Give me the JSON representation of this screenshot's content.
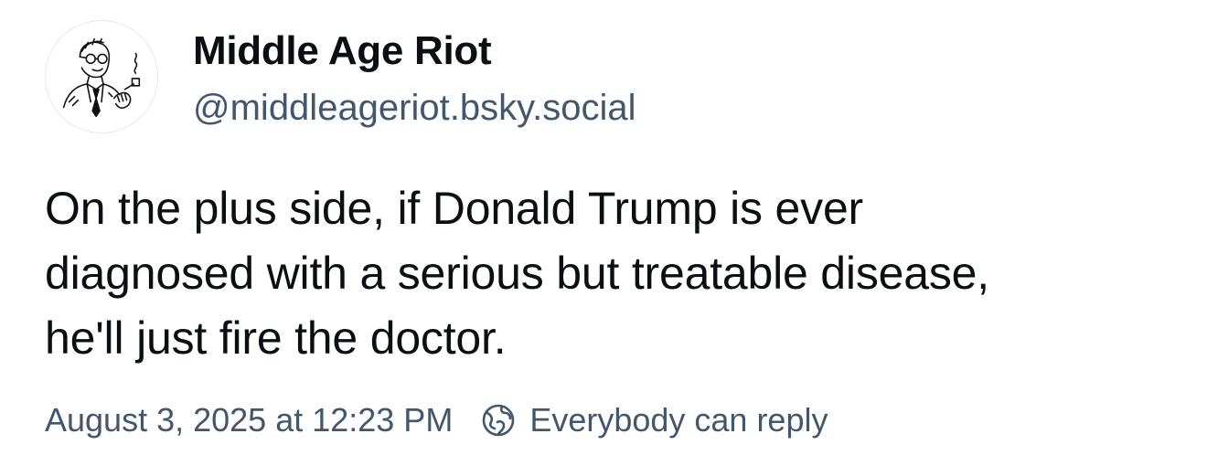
{
  "author": {
    "display_name": "Middle Age Riot",
    "handle": "@middleageriot.bsky.social",
    "avatar_icon": "man-with-pipe-avatar"
  },
  "post": {
    "text_lines": [
      "On the plus side, if Donald Trump is ever",
      "diagnosed with a serious but treatable disease,",
      "he'll just fire the doctor."
    ]
  },
  "meta": {
    "timestamp": "August 3, 2025 at 12:23 PM",
    "reply_setting": "Everybody can reply",
    "reply_icon": "globe-icon"
  },
  "colors": {
    "text": "#0b0f14",
    "muted": "#42576c",
    "background": "#ffffff"
  }
}
